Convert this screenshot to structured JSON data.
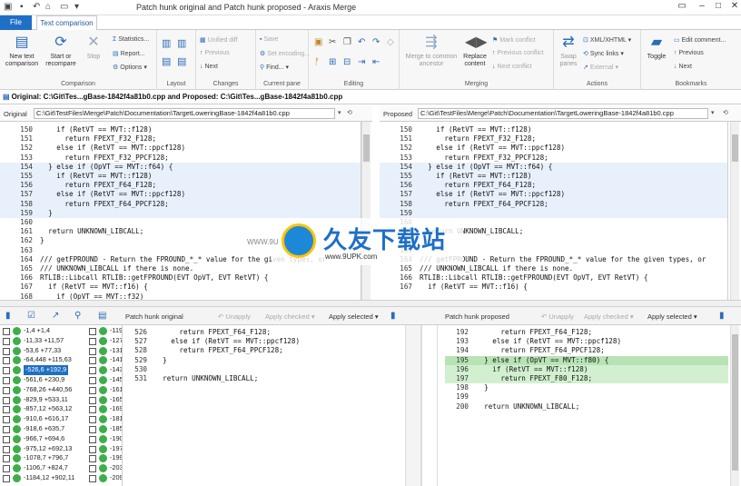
{
  "window": {
    "title": "Patch hunk original and Patch hunk proposed - Araxis Merge"
  },
  "tabs": {
    "file": "File",
    "text": "Text comparison"
  },
  "ribbon": {
    "new_text": "New text comparison",
    "start_reompare": "Start or recompare",
    "stop": "Stop",
    "statistics": "Statistics...",
    "report": "Report...",
    "options": "Options",
    "comparison": "Comparison",
    "layout": "Layout",
    "unified_diff": "Unified diff",
    "previous": "Previous",
    "next": "Next",
    "changes": "Changes",
    "save": "Save",
    "set_encoding": "Set encoding...",
    "find": "Find...",
    "current_pane": "Current pane",
    "editing": "Editing",
    "merge_to_common": "Merge to common ancestor",
    "replace_content": "Replace content",
    "mark_conflict": "Mark conflict",
    "previous_conflict": "Previous conflict",
    "next_conflict": "Next conflict",
    "merging": "Merging",
    "swap_panes": "Swap panes",
    "xml_xhtml": "XML/XHTML",
    "sync_links": "Sync links",
    "external": "External",
    "actions": "Actions",
    "toggle": "Toggle",
    "edit_comment": "Edit comment...",
    "prev_bm": "Previous",
    "next_bm": "Next",
    "bookmarks": "Bookmarks"
  },
  "address": "Original: C:\\Git\\Tes...gBase-1842f4a81b0.cpp and Proposed: C:\\Git\\Tes...gBase-1842f4a81b0.cpp",
  "paths": {
    "original_label": "Original",
    "original_path": "C:\\Git\\TestFiles\\Merge\\Patch\\Documentation\\TargetLoweringBase-1842f4a81b0.cpp",
    "proposed_label": "Proposed",
    "proposed_path": "C:\\Git\\TestFiles\\Merge\\Patch\\Documentation\\TargetLoweringBase-1842f4a81b0.cpp"
  },
  "left_code": [
    {
      "n": "150",
      "t": "    if (RetVT == MVT::f128)"
    },
    {
      "n": "151",
      "t": "      return FPEXT_F32_F128;"
    },
    {
      "n": "152",
      "t": "    else if (RetVT == MVT::ppcf128)"
    },
    {
      "n": "153",
      "t": "      return FPEXT_F32_PPCF128;"
    },
    {
      "n": "154",
      "t": "  } else if (OpVT == MVT::f64) {"
    },
    {
      "n": "155",
      "t": "    if (RetVT == MVT::f128)"
    },
    {
      "n": "156",
      "t": "      return FPEXT_F64_F128;"
    },
    {
      "n": "157",
      "t": "    else if (RetVT == MVT::ppcf128)"
    },
    {
      "n": "158",
      "t": "      return FPEXT_F64_PPCF128;"
    },
    {
      "n": "159",
      "t": "  }"
    },
    {
      "n": "160",
      "t": ""
    },
    {
      "n": "161",
      "t": "  return UNKNOWN_LIBCALL;"
    },
    {
      "n": "162",
      "t": "}"
    },
    {
      "n": "163",
      "t": ""
    },
    {
      "n": "164",
      "t": "/// getFPROUND - Return the FPROUND_*_* value for the given types, or"
    },
    {
      "n": "165",
      "t": "/// UNKNOWN_LIBCALL if there is none."
    },
    {
      "n": "166",
      "t": "RTLIB::Libcall RTLIB::getFPROUND(EVT OpVT, EVT RetVT) {"
    },
    {
      "n": "167",
      "t": "  if (RetVT == MVT::f16) {"
    },
    {
      "n": "168",
      "t": "    if (OpVT == MVT::f32)"
    }
  ],
  "right_code": [
    {
      "n": "150",
      "t": "    if (RetVT == MVT::f128)"
    },
    {
      "n": "151",
      "t": "      return FPEXT_F32_F128;"
    },
    {
      "n": "152",
      "t": "    else if (RetVT == MVT::ppcf128)"
    },
    {
      "n": "153",
      "t": "      return FPEXT_F32_PPCF128;"
    },
    {
      "n": "154",
      "t": "  } else if (OpVT == MVT::f64) {"
    },
    {
      "n": "155",
      "t": "    if (RetVT == MVT::f128)"
    },
    {
      "n": "156",
      "t": "      return FPEXT_F64_F128;"
    },
    {
      "n": "157",
      "t": "    else if (RetVT == MVT::ppcf128)"
    },
    {
      "n": "158",
      "t": "      return FPEXT_F64_PPCF128;"
    },
    {
      "n": "159",
      "t": ""
    },
    {
      "n": "160",
      "t": ""
    },
    {
      "n": "161",
      "t": "  return UNKNOWN_LIBCALL;"
    },
    {
      "n": "162",
      "t": ""
    },
    {
      "n": "163",
      "t": ""
    },
    {
      "n": "164",
      "t": "/// getFPROUND - Return the FPROUND_*_* value for the given types, or"
    },
    {
      "n": "165",
      "t": "/// UNKNOWN_LIBCALL if there is none."
    },
    {
      "n": "166",
      "t": "RTLIB::Libcall RTLIB::getFPROUND(EVT OpVT, EVT RetVT) {"
    },
    {
      "n": "167",
      "t": "  if (RetVT == MVT::f16) {"
    }
  ],
  "lowtool": {
    "left_title": "Patch hunk original",
    "unapply": "Unapply",
    "apply_checked": "Apply checked",
    "apply_selected": "Apply selected",
    "right_title": "Patch hunk proposed"
  },
  "hunks": [
    {
      "v": "-1,4 +1,4",
      "r": "-119"
    },
    {
      "v": "-11,33 +11,57",
      "r": "-127"
    },
    {
      "v": "-53,6 +77,33",
      "r": "-131"
    },
    {
      "v": "-64,448 +115,63",
      "r": "-141"
    },
    {
      "v": "-526,6 +192,9",
      "r": "-143",
      "sel": true
    },
    {
      "v": "-561,6 +230,9",
      "r": "-145"
    },
    {
      "v": "-768,26 +440,56",
      "r": "-161"
    },
    {
      "v": "-829,9 +533,11",
      "r": "-165"
    },
    {
      "v": "-857,12 +563,12",
      "r": "-169"
    },
    {
      "v": "-910,6 +616,17",
      "r": "-181"
    },
    {
      "v": "-918,6 +635,7",
      "r": "-185"
    },
    {
      "v": "-966,7 +694,6",
      "r": "-190"
    },
    {
      "v": "-975,12 +692,13",
      "r": "-197"
    },
    {
      "v": "-1078,7 +796,7",
      "r": "-199"
    },
    {
      "v": "-1106,7 +824,7",
      "r": "-203"
    },
    {
      "v": "-1184,12 +902,11",
      "r": "-209"
    }
  ],
  "low_left": [
    {
      "n": "526",
      "t": "      return FPEXT_F64_F128;"
    },
    {
      "n": "527",
      "t": "    else if (RetVT == MVT::ppcf128)"
    },
    {
      "n": "528",
      "t": "      return FPEXT_F64_PPCF128;"
    },
    {
      "n": "529",
      "t": "  }"
    },
    {
      "n": "530",
      "t": ""
    },
    {
      "n": "531",
      "t": "  return UNKNOWN_LIBCALL;"
    }
  ],
  "low_right": [
    {
      "n": "192",
      "t": "      return FPEXT_F64_F128;"
    },
    {
      "n": "193",
      "t": "    else if (RetVT == MVT::ppcf128)"
    },
    {
      "n": "194",
      "t": "      return FPEXT_F64_PPCF128;"
    },
    {
      "n": "195",
      "t": "  } else if (OpVT == MVT::f80) {",
      "g": 2
    },
    {
      "n": "196",
      "t": "    if (RetVT == MVT::f128)",
      "g": 1
    },
    {
      "n": "197",
      "t": "      return FPEXT_F80_F128;",
      "g": 1
    },
    {
      "n": "198",
      "t": "  }"
    },
    {
      "n": "199",
      "t": ""
    },
    {
      "n": "200",
      "t": "  return UNKNOWN_LIBCALL;"
    }
  ],
  "watermark": {
    "cn": "久友下载站",
    "url": "www.9UPK.com",
    "www": "WWW.9U"
  }
}
